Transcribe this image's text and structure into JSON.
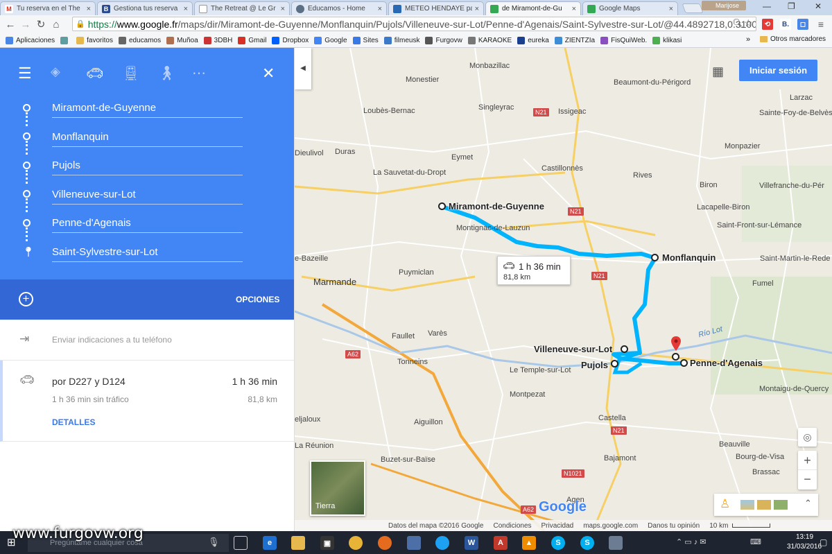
{
  "browser": {
    "tabs": [
      {
        "label": "Tu reserva en el The",
        "icon": "gmail-icon",
        "color": "#d93025",
        "glyph": "M"
      },
      {
        "label": "Gestiona tus reserva",
        "icon": "booking-icon",
        "color": "#2a4c8f",
        "glyph": "B"
      },
      {
        "label": "The Retreat @ Le Gr",
        "icon": "page-icon",
        "color": "#8c8c8c",
        "glyph": ""
      },
      {
        "label": "Educamos - Home",
        "icon": "educamos-icon",
        "color": "#5c6f84",
        "glyph": ""
      },
      {
        "label": "METEO HENDAYE pa",
        "icon": "meteo-icon",
        "color": "#2a6ab5",
        "glyph": ""
      },
      {
        "label": "de Miramont-de-Gu",
        "icon": "maps-icon",
        "color": "#34a853",
        "glyph": ""
      },
      {
        "label": "Google Maps",
        "icon": "maps-icon",
        "color": "#34a853",
        "glyph": ""
      }
    ],
    "user": "Marijose",
    "url_scheme": "https://",
    "url_host": "www.google.fr",
    "url_path": "/maps/dir/Miramont-de-Guyenne/Monflanquin/Pujols/Villeneuve-sur-Lot/Penne-d'Agenais/Saint-Sylvestre-sur-Lot/@44.4892718,0.3100",
    "bookmarks": [
      {
        "label": "Aplicaciones",
        "color": "#4a86e8"
      },
      {
        "label": "",
        "color": "#5f9ea0"
      },
      {
        "label": "favoritos",
        "color": "#e6b84d"
      },
      {
        "label": "educamos",
        "color": "#666666"
      },
      {
        "label": "Muñoa",
        "color": "#b07050"
      },
      {
        "label": "3DBH",
        "color": "#cc3333"
      },
      {
        "label": "Gmail",
        "color": "#d93025"
      },
      {
        "label": "Dropbox",
        "color": "#0061fe"
      },
      {
        "label": "Google",
        "color": "#4285f4"
      },
      {
        "label": "Sites",
        "color": "#3b78e7"
      },
      {
        "label": "filmeusk",
        "color": "#3a7ac8"
      },
      {
        "label": "Furgovw",
        "color": "#555555"
      },
      {
        "label": "KARAOKE",
        "color": "#777777"
      },
      {
        "label": "eureka",
        "color": "#1a3f8f"
      },
      {
        "label": "ZIENTZIa",
        "color": "#3c8cd8"
      },
      {
        "label": "FisQuiWeb.",
        "color": "#8a4fbf"
      },
      {
        "label": "klikasi",
        "color": "#4caf50"
      }
    ],
    "bookmarks_overflow": "»",
    "other_bookmarks": "Otros marcadores"
  },
  "directions": {
    "waypoints": [
      "Miramont-de-Guyenne",
      "Monflanquin",
      "Pujols",
      "Villeneuve-sur-Lot",
      "Penne-d'Agenais",
      "Saint-Sylvestre-sur-Lot"
    ],
    "options_label": "OPCIONES",
    "send_to_phone": "Enviar indicaciones a tu teléfono",
    "route": {
      "via": "por D227 y D124",
      "duration": "1 h 36 min",
      "no_traffic": "1 h 36 min sin tráfico",
      "distance": "81,8 km",
      "details_label": "DETALLES"
    }
  },
  "map": {
    "sign_in": "Iniciar sesión",
    "info_duration": "1 h 36 min",
    "info_distance": "81,8 km",
    "route_labels": {
      "miramont": "Miramont-de-Guyenne",
      "monflanquin": "Monflanquin",
      "villeneuve": "Villeneuve-sur-Lot",
      "pujols": "Pujols",
      "penne": "Penne-d'Agenais"
    },
    "towns": {
      "monbazillac": "Monbazillac",
      "monestier": "Monestier",
      "beaumont": "Beaumont-du-Périgord",
      "larzac": "Larzac",
      "loubes": "Loubès-Bernac",
      "singleyrac": "Singleyrac",
      "issigeac": "Issigeac",
      "sainte_foy": "Sainte-Foy-de-Belvès",
      "dieulivol": "Dieulivol",
      "duras": "Duras",
      "eymet": "Eymet",
      "monpazier": "Monpazier",
      "sauvetat": "La Sauvetat-du-Dropt",
      "castillonnes": "Castillonnès",
      "rives": "Rives",
      "villefranche": "Villefranche-du-Pér",
      "biron": "Biron",
      "lacapelle": "Lacapelle-Biron",
      "montignac": "Montignac-de-Lauzun",
      "saint_front": "Saint-Front-sur-Lémance",
      "bazeille": "e-Bazeille",
      "saint_martin": "Saint-Martin-le-Rede",
      "puymiclan": "Puymiclan",
      "fumel": "Fumel",
      "faullet": "Faullet",
      "vares": "Varès",
      "tonneins": "Tonneins",
      "le_temple": "Le Temple-sur-Lot",
      "montaigu": "Montaigu-de-Quercy",
      "montpezat": "Montpezat",
      "jaloux": "eljaloux",
      "aiguillon": "Aiguillon",
      "castella": "Castella",
      "reunion": "La Réunion",
      "beauville": "Beauville",
      "buzet": "Buzet-sur-Baïse",
      "bajamont": "Bajamont",
      "bourg": "Bourg-de-Visa",
      "brassac": "Brassac",
      "agen": "Agen"
    },
    "cities": {
      "marmande": "Marmande"
    },
    "river": "Río Lot",
    "shields": {
      "n21_a": "N21",
      "n21_b": "N21",
      "n21_c": "N21",
      "n21_d": "N21",
      "a62_a": "A62",
      "a62_b": "A62",
      "n1021": "N1021"
    },
    "earth_label": "Tierra",
    "google_logo": "Google",
    "footer": [
      "Datos del mapa ©2016 Google",
      "Condiciones",
      "Privacidad",
      "maps.google.com",
      "Danos tu opinión",
      "10 km"
    ]
  },
  "taskbar": {
    "search_placeholder": "Pregúntame cualquier cosa",
    "time": "13:19",
    "date": "31/03/2016"
  },
  "watermark": "www.furgovw.org",
  "colors": {
    "route_blue": "#4285f4",
    "panel_blue": "#4285f4",
    "options_blue": "#3367d6",
    "route_line": "#00b3fd"
  }
}
